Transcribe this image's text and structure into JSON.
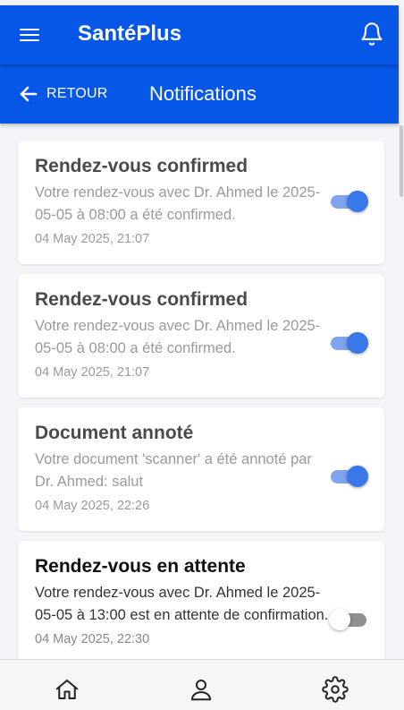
{
  "app": {
    "title": "SantéPlus"
  },
  "subheader": {
    "back_label": "RETOUR",
    "title": "Notifications"
  },
  "notifications": [
    {
      "title": "Rendez-vous confirmed",
      "message": "Votre rendez-vous avec Dr. Ahmed le 2025-05-05 à 08:00 a été confirmed.",
      "time": "04 May 2025, 21:07",
      "toggle_on": true
    },
    {
      "title": "Rendez-vous confirmed",
      "message": "Votre rendez-vous avec Dr. Ahmed le 2025-05-05 à 08:00 a été confirmed.",
      "time": "04 May 2025, 21:07",
      "toggle_on": true
    },
    {
      "title": "Document annoté",
      "message": "Votre document 'scanner' a été annoté par Dr. Ahmed: salut",
      "time": "04 May 2025, 22:26",
      "toggle_on": true
    },
    {
      "title": "Rendez-vous en attente",
      "message": "Votre rendez-vous avec Dr. Ahmed le 2025-05-05 à 13:00 est en attente de confirmation.",
      "time": "04 May 2025, 22:30",
      "toggle_on": false
    }
  ],
  "bottom_nav": [
    {
      "icon": "home-icon"
    },
    {
      "icon": "user-icon"
    },
    {
      "icon": "gear-icon"
    }
  ],
  "colors": {
    "primary": "#0657e8",
    "toggle_on": "#3a78ea",
    "background": "#f3f4f8"
  }
}
